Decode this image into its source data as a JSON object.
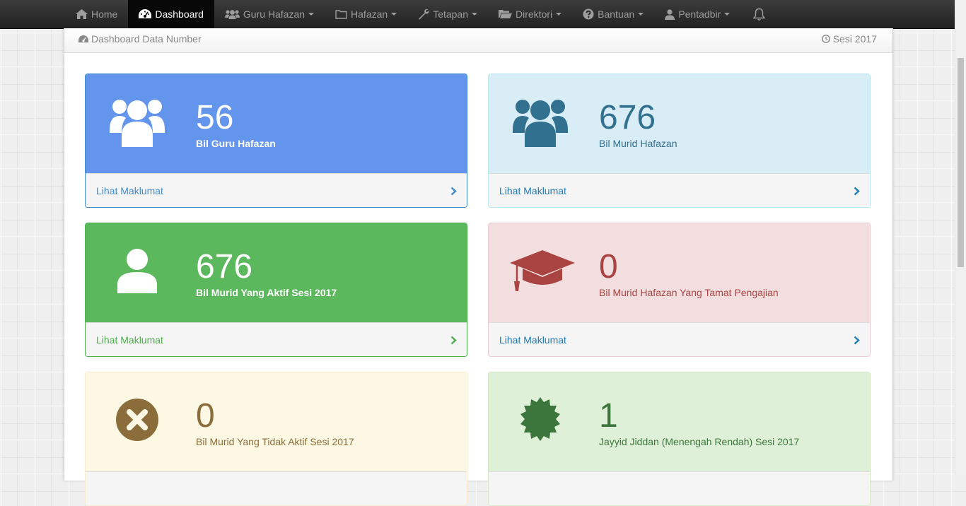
{
  "nav": {
    "items": [
      {
        "label": "Home",
        "icon": "home-icon"
      },
      {
        "label": "Dashboard",
        "icon": "dashboard-icon"
      },
      {
        "label": "Guru Hafazan",
        "icon": "users-icon"
      },
      {
        "label": "Hafazan",
        "icon": "folder-icon"
      },
      {
        "label": "Tetapan",
        "icon": "wrench-icon"
      },
      {
        "label": "Direktori",
        "icon": "folder-open-icon"
      },
      {
        "label": "Bantuan",
        "icon": "question-circle-icon"
      },
      {
        "label": "Pentadbir",
        "icon": "user-icon"
      }
    ],
    "notification_icon": "bell-icon"
  },
  "panel": {
    "title": "Dashboard Data Number",
    "session": "Sesi 2017"
  },
  "cards": [
    {
      "value": "56",
      "label": "Bil Guru Hafazan",
      "link": "Lihat Maklumat",
      "icon": "users-icon",
      "color": "#6495ed"
    },
    {
      "value": "676",
      "label": "Bil Murid Hafazan",
      "link": "Lihat Maklumat",
      "icon": "users-icon",
      "color": "#31708f"
    },
    {
      "value": "676",
      "label": "Bil Murid Yang Aktif Sesi 2017",
      "link": "Lihat Maklumat",
      "icon": "user-icon",
      "color": "#5cb85c"
    },
    {
      "value": "0",
      "label": "Bil Murid Hafazan Yang Tamat Pengajian",
      "link": "Lihat Maklumat",
      "icon": "graduation-cap-icon",
      "color": "#a94442"
    },
    {
      "value": "0",
      "label": "Bil Murid Yang Tidak Aktif Sesi 2017",
      "icon": "times-circle-icon",
      "color": "#8a6d3b"
    },
    {
      "value": "1",
      "label": "Jayyid Jiddan (Menengah Rendah) Sesi 2017",
      "icon": "certificate-icon",
      "color": "#3c763d"
    }
  ]
}
